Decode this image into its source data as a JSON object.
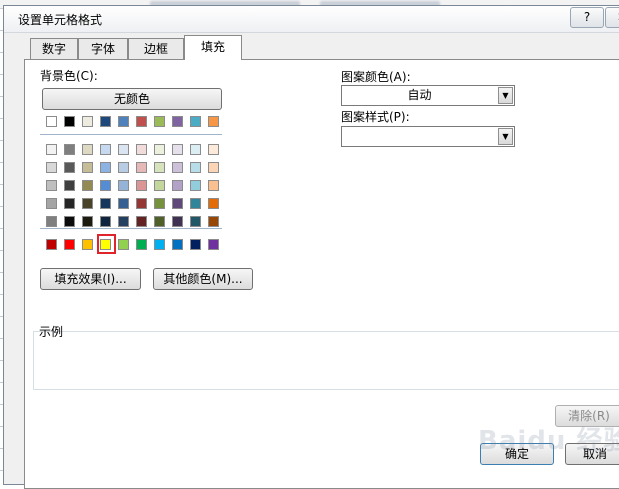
{
  "background_blur": [
    "",
    ""
  ],
  "dialog": {
    "title": "设置单元格格式",
    "help_label": "?",
    "close_label": "✕"
  },
  "tabs": [
    {
      "label": "数字",
      "active": false
    },
    {
      "label": "字体",
      "active": false
    },
    {
      "label": "边框",
      "active": false
    },
    {
      "label": "填充",
      "active": true
    }
  ],
  "fill": {
    "background_color_label": "背景色(C):",
    "no_color_button": "无颜色",
    "theme_colors": [
      [
        "#ffffff",
        "#000000",
        "#eeece1",
        "#1f497d",
        "#4f81bd",
        "#c0504d",
        "#9bbb59",
        "#8064a2",
        "#4bacc6",
        "#f79646"
      ],
      [
        "#f2f2f2",
        "#7f7f7f",
        "#ddd9c3",
        "#c6d9f0",
        "#dbe5f1",
        "#f2dcdb",
        "#ebf1dd",
        "#e5e0ec",
        "#dbeef3",
        "#fdeada"
      ],
      [
        "#d8d8d8",
        "#595959",
        "#c4bd97",
        "#8db3e2",
        "#b8cce4",
        "#e5b9b7",
        "#d7e3bc",
        "#ccc1d9",
        "#b7dde8",
        "#fbd5b5"
      ],
      [
        "#bfbfbf",
        "#3f3f3f",
        "#938953",
        "#548dd4",
        "#95b3d7",
        "#d99694",
        "#c3d69b",
        "#b2a2c7",
        "#92cddc",
        "#fac08f"
      ],
      [
        "#a5a5a5",
        "#262626",
        "#494429",
        "#17365d",
        "#366092",
        "#953734",
        "#76923c",
        "#5f497a",
        "#31859b",
        "#e36c09"
      ],
      [
        "#7f7f7f",
        "#0c0c0c",
        "#1d1b10",
        "#0f243e",
        "#244061",
        "#632423",
        "#4f6128",
        "#3f3151",
        "#205867",
        "#974806"
      ]
    ],
    "standard_colors": [
      "#c00000",
      "#ff0000",
      "#ffc000",
      "#ffff00",
      "#92d050",
      "#00b050",
      "#00b0f0",
      "#0070c0",
      "#002060",
      "#7030a0"
    ],
    "selected_color": "#ffff00",
    "fill_effects_button": "填充效果(I)...",
    "more_colors_button": "其他颜色(M)...",
    "pattern_color_label": "图案颜色(A):",
    "pattern_color_value": "自动",
    "pattern_style_label": "图案样式(P):",
    "pattern_style_value": "",
    "sample_label": "示例",
    "clear_button": "清除(R)",
    "ok_button": "确定",
    "cancel_button": "取消"
  },
  "watermark": "Baidu 经验"
}
